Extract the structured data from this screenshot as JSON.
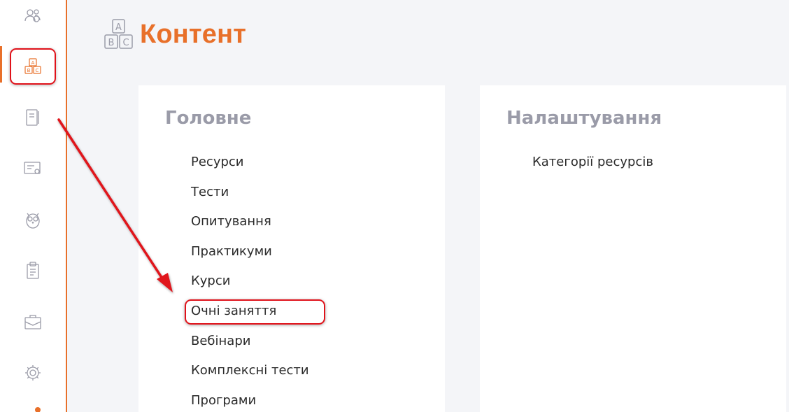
{
  "header": {
    "title": "Контент",
    "icon": "abc-blocks-icon"
  },
  "sidebar": {
    "accent_color": "#e8702a",
    "items": [
      {
        "name": "users-icon"
      },
      {
        "name": "abc-blocks-icon",
        "active": true
      },
      {
        "name": "journal-icon"
      },
      {
        "name": "certificate-icon"
      },
      {
        "name": "owl-icon"
      },
      {
        "name": "clipboard-icon"
      },
      {
        "name": "briefcase-icon"
      },
      {
        "name": "gear-icon"
      }
    ]
  },
  "main_card": {
    "heading": "Головне",
    "items": [
      "Ресурси",
      "Тести",
      "Опитування",
      "Практикуми",
      "Курси",
      "Очні заняття",
      "Вебінари",
      "Комплексні тести",
      "Програми"
    ],
    "highlighted_item": "Очні заняття"
  },
  "settings_card": {
    "heading": "Налаштування",
    "items": [
      "Категорії ресурсів"
    ]
  },
  "colors": {
    "accent": "#e8702a",
    "annotation_red": "#e0121a",
    "heading_gray": "#9a9ba8",
    "background": "#f4f5f8"
  }
}
